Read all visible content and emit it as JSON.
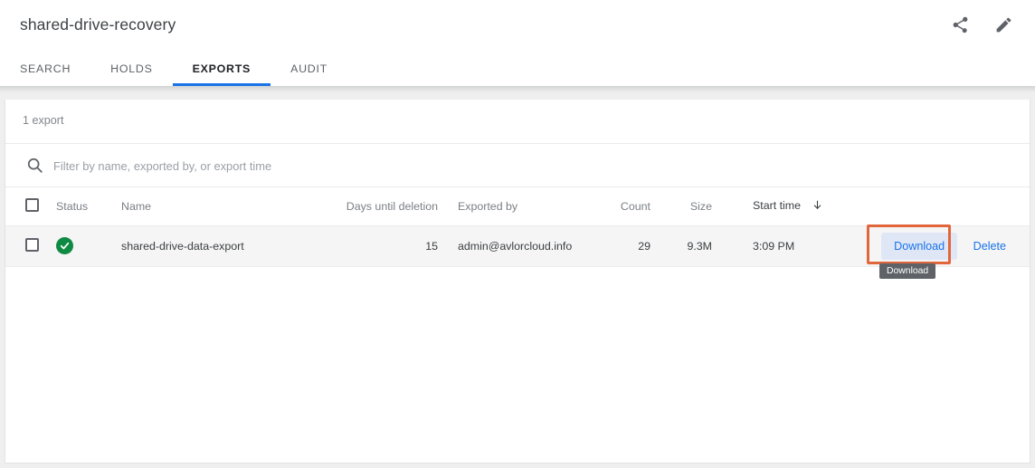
{
  "header": {
    "title": "shared-drive-recovery",
    "actions": [
      {
        "name": "share-icon",
        "label": "Share"
      },
      {
        "name": "edit-icon",
        "label": "Edit"
      }
    ]
  },
  "tabs": [
    {
      "label": "SEARCH",
      "active": false
    },
    {
      "label": "HOLDS",
      "active": false
    },
    {
      "label": "EXPORTS",
      "active": true
    },
    {
      "label": "AUDIT",
      "active": false
    }
  ],
  "content": {
    "count_label": "1 export",
    "filter_placeholder": "Filter by name, exported by, or export time",
    "filter_value": ""
  },
  "table": {
    "columns": [
      {
        "key": "status",
        "label": "Status"
      },
      {
        "key": "name",
        "label": "Name"
      },
      {
        "key": "days",
        "label": "Days until deletion"
      },
      {
        "key": "exported_by",
        "label": "Exported by"
      },
      {
        "key": "count",
        "label": "Count"
      },
      {
        "key": "size",
        "label": "Size"
      },
      {
        "key": "start_time",
        "label": "Start time"
      }
    ],
    "sort": {
      "column": "start_time",
      "direction": "descending",
      "arrow": "↓"
    },
    "rows": [
      {
        "status": "complete",
        "name": "shared-drive-data-export",
        "days": "15",
        "exported_by": "admin@avlorcloud.info",
        "count": "29",
        "size": "9.3M",
        "start_time": "3:09 PM",
        "actions": {
          "download": "Download",
          "delete": "Delete"
        }
      }
    ]
  },
  "tooltip": {
    "text": "Download"
  },
  "colors": {
    "accent": "#1a73e8",
    "status_ok": "#0f8a43",
    "annotation": "#e2663c",
    "tooltip_bg": "#5f6368",
    "focus_bg": "#dfe7f7",
    "row_bg": "#f5f5f5"
  }
}
